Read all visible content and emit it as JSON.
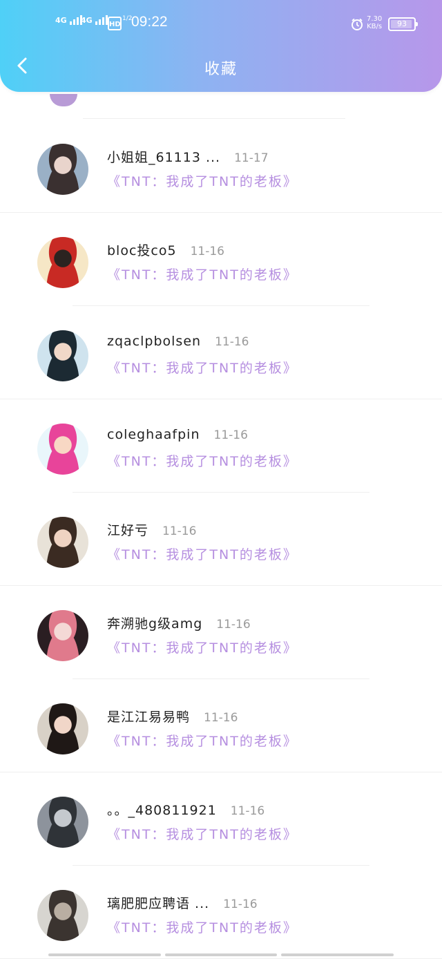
{
  "status_bar": {
    "net1": "4G",
    "net2": "4G",
    "hd": "HD",
    "hd_sub": "1/2",
    "time": "09:22",
    "speed_value": "7.30",
    "speed_unit": "KB/s",
    "battery_level": 93,
    "battery": "93"
  },
  "header": {
    "title": "收藏",
    "icon": "chevron-left-icon"
  },
  "items": [
    {
      "name": "小姐姐_61113 ...",
      "date": "11-17",
      "book": "《TNT：我成了TNT的老板》",
      "avatar_colors": [
        "#9ab0c6",
        "#3a3030",
        "#e9d4cc"
      ]
    },
    {
      "name": "bloc投co5",
      "date": "11-16",
      "book": "《TNT：我成了TNT的老板》",
      "avatar_colors": [
        "#f6e7c6",
        "#c82a24",
        "#2b2320"
      ]
    },
    {
      "name": "zqaclpbolsen",
      "date": "11-16",
      "book": "《TNT：我成了TNT的老板》",
      "avatar_colors": [
        "#cfe3ee",
        "#1c2a33",
        "#f1d8c8"
      ]
    },
    {
      "name": "coleghaafpin",
      "date": "11-16",
      "book": "《TNT：我成了TNT的老板》",
      "avatar_colors": [
        "#e9f6fb",
        "#e8449a",
        "#f8d8c4"
      ]
    },
    {
      "name": "江好亏",
      "date": "11-16",
      "book": "《TNT：我成了TNT的老板》",
      "avatar_colors": [
        "#e8e2d8",
        "#3b2b22",
        "#efd3c2"
      ]
    },
    {
      "name": "奔溯驰g级amg",
      "date": "11-16",
      "book": "《TNT：我成了TNT的老板》",
      "avatar_colors": [
        "#2a1e22",
        "#e07a8c",
        "#f4d9d6"
      ]
    },
    {
      "name": "是江江易易鸭",
      "date": "11-16",
      "book": "《TNT：我成了TNT的老板》",
      "avatar_colors": [
        "#d8d1c7",
        "#1f1816",
        "#f1d6c8"
      ]
    },
    {
      "name": "。。_480811921",
      "date": "11-16",
      "book": "《TNT：我成了TNT的老板》",
      "avatar_colors": [
        "#8d939c",
        "#2f3338",
        "#c5c9ce"
      ]
    },
    {
      "name": "璃肥肥应聘语 ...",
      "date": "11-16",
      "book": "《TNT：我成了TNT的老板》",
      "avatar_colors": [
        "#d7d5d0",
        "#3b3430",
        "#b9aea2"
      ]
    }
  ]
}
